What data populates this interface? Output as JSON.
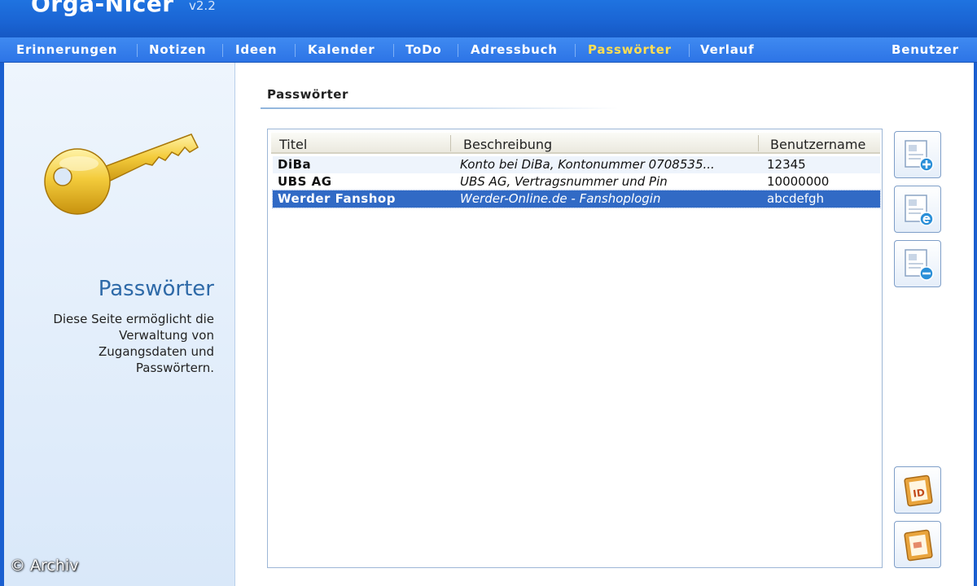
{
  "app": {
    "title": "Orga-Nicer",
    "version": "v2.2"
  },
  "nav": {
    "items": [
      "Erinnerungen",
      "Notizen",
      "Ideen",
      "Kalender",
      "ToDo",
      "Adressbuch",
      "Passwörter",
      "Verlauf"
    ],
    "active": "Passwörter",
    "user_label": "Benutzer"
  },
  "sidebar": {
    "heading": "Passwörter",
    "description": "Diese Seite ermöglicht die Verwaltung von Zugangsdaten und Passwörtern.",
    "watermark": "© Archiv"
  },
  "main": {
    "title": "Passwörter",
    "columns": [
      "Titel",
      "Beschreibung",
      "Benutzername"
    ],
    "rows": [
      {
        "title": "DiBa",
        "description": "Konto bei DiBa, Kontonummer 0708535...",
        "username": "12345"
      },
      {
        "title": "UBS AG",
        "description": "UBS AG, Vertragsnummer und Pin",
        "username": "10000000"
      },
      {
        "title": "Werder Fanshop",
        "description": "Werder-Online.de - Fanshoplogin",
        "username": "abcdefgh"
      }
    ],
    "selected_row": 2
  },
  "actions": {
    "icons": [
      "add-entry-icon",
      "edit-entry-icon",
      "remove-entry-icon",
      "id-card-icon",
      "image-card-icon"
    ],
    "id_badge_text": "ID"
  },
  "colors": {
    "titlebar": "#1a64d3",
    "navbar": "#3580ec",
    "active_nav": "#ffde52",
    "selection": "#316ac5",
    "sidebar_heading": "#2e6aa8"
  }
}
